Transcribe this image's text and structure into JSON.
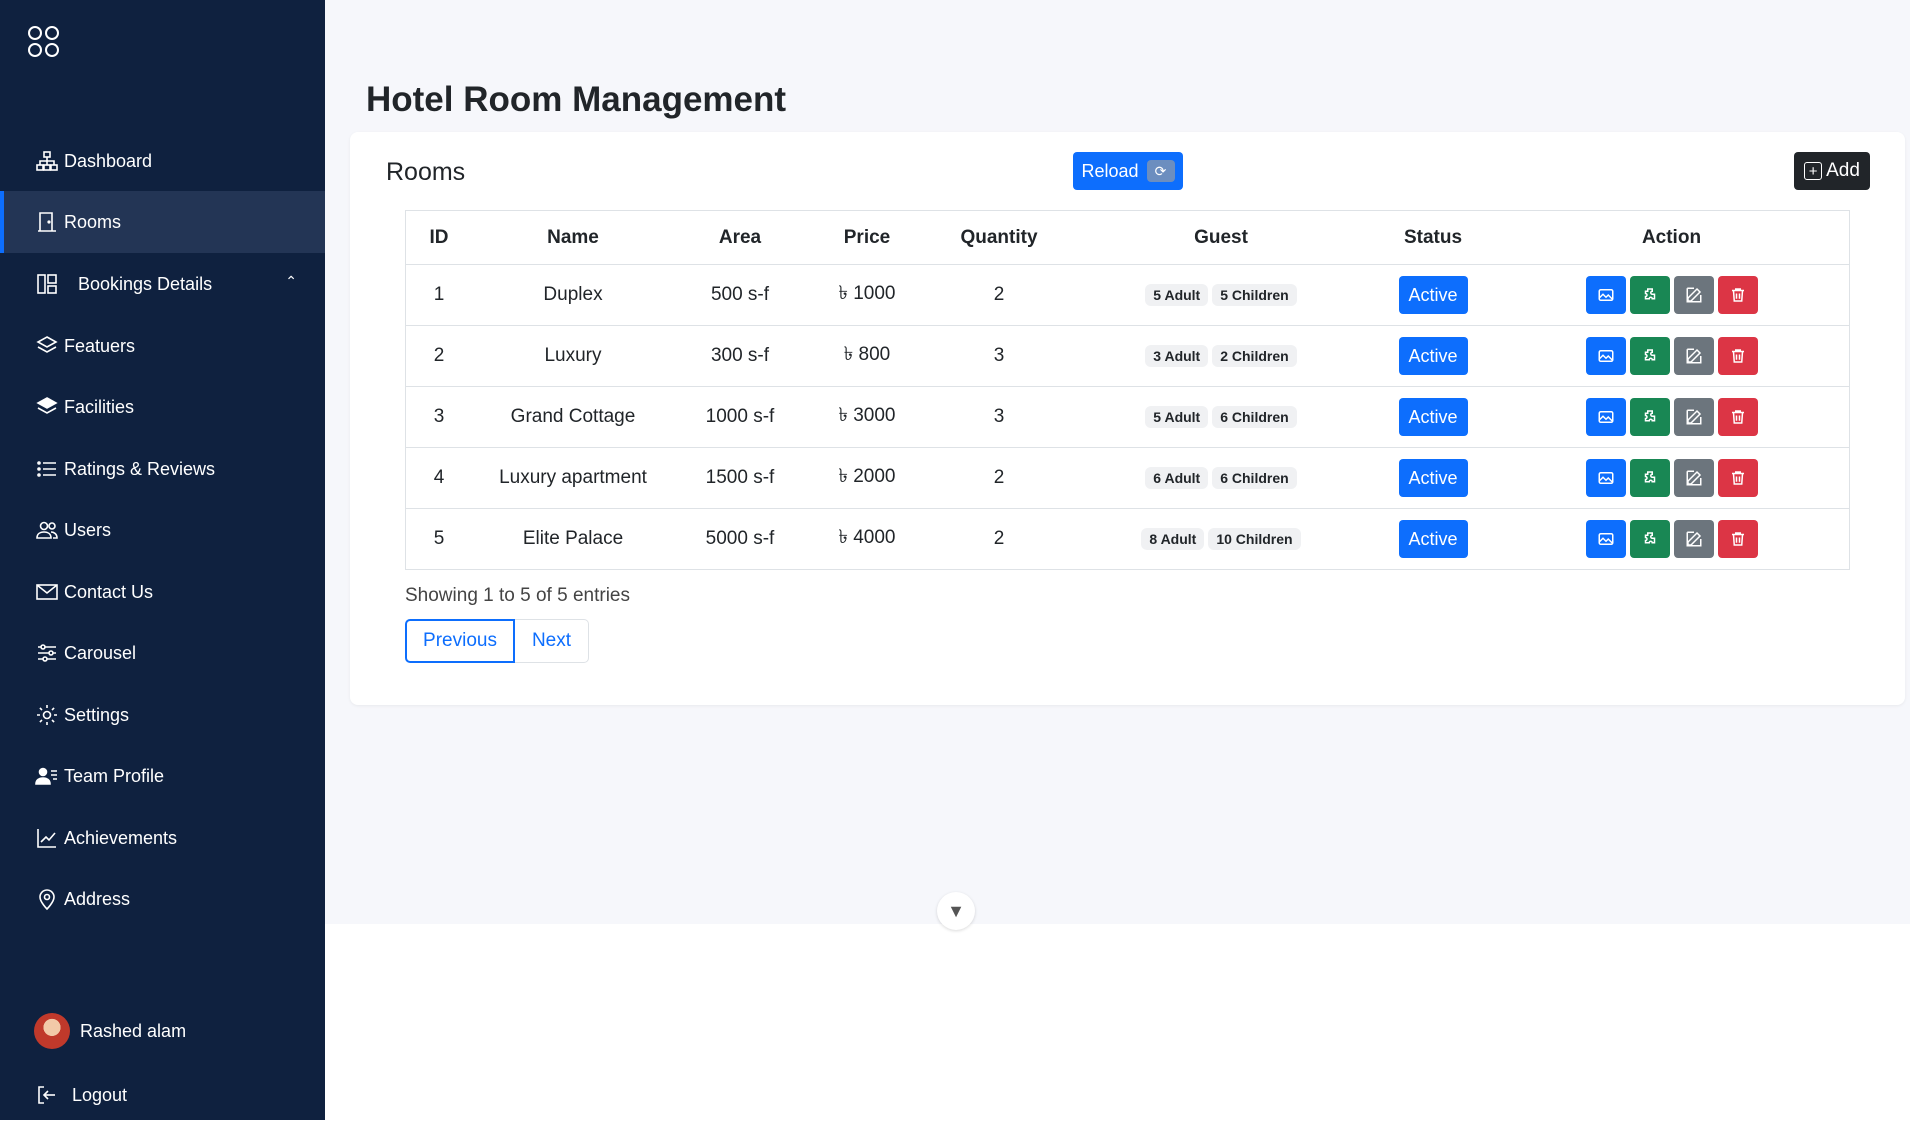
{
  "sidebar": {
    "items": [
      {
        "label": "Dashboard",
        "icon": "diagram-icon",
        "active": false
      },
      {
        "label": "Rooms",
        "icon": "door-icon",
        "active": true
      },
      {
        "label": "Bookings Details",
        "icon": "layout-icon",
        "active": false,
        "expandable": true
      },
      {
        "label": "Featuers",
        "icon": "layers-icon",
        "active": false
      },
      {
        "label": "Facilities",
        "icon": "layers-filled-icon",
        "active": false
      },
      {
        "label": "Ratings & Reviews",
        "icon": "list-icon",
        "active": false
      },
      {
        "label": "Users",
        "icon": "people-icon",
        "active": false
      },
      {
        "label": "Contact Us",
        "icon": "envelope-icon",
        "active": false
      },
      {
        "label": "Carousel",
        "icon": "sliders-icon",
        "active": false
      },
      {
        "label": "Settings",
        "icon": "gear-icon",
        "active": false
      },
      {
        "label": "Team Profile",
        "icon": "person-lines-icon",
        "active": false
      },
      {
        "label": "Achievements",
        "icon": "graph-up-icon",
        "active": false
      },
      {
        "label": "Address",
        "icon": "geo-pin-icon",
        "active": false
      }
    ],
    "user": {
      "name": "Rashed alam"
    },
    "logout_label": "Logout"
  },
  "page": {
    "title": "Hotel Room Management"
  },
  "rooms_card": {
    "title": "Rooms",
    "reload_label": "Reload",
    "add_label": "Add",
    "columns": [
      "ID",
      "Name",
      "Area",
      "Price",
      "Quantity",
      "Guest",
      "Status",
      "Action"
    ],
    "rows": [
      {
        "id": "1",
        "name": "Duplex",
        "area": "500 s-f",
        "price": "৳ 1000",
        "quantity": "2",
        "adult": "5 Adult",
        "children": "5 Children",
        "status": "Active"
      },
      {
        "id": "2",
        "name": "Luxury",
        "area": "300 s-f",
        "price": "৳ 800",
        "quantity": "3",
        "adult": "3 Adult",
        "children": "2 Children",
        "status": "Active"
      },
      {
        "id": "3",
        "name": "Grand Cottage",
        "area": "1000 s-f",
        "price": "৳ 3000",
        "quantity": "3",
        "adult": "5 Adult",
        "children": "6 Children",
        "status": "Active"
      },
      {
        "id": "4",
        "name": "Luxury apartment",
        "area": "1500 s-f",
        "price": "৳ 2000",
        "quantity": "2",
        "adult": "6 Adult",
        "children": "6 Children",
        "status": "Active"
      },
      {
        "id": "5",
        "name": "Elite Palace",
        "area": "5000 s-f",
        "price": "৳ 4000",
        "quantity": "2",
        "adult": "8 Adult",
        "children": "10 Children",
        "status": "Active"
      }
    ],
    "showing_text": "Showing 1 to 5 of 5 entries",
    "pagination": {
      "previous": "Previous",
      "next": "Next"
    }
  },
  "colors": {
    "sidebar_bg": "#0f213f",
    "primary": "#0d6efd",
    "success": "#198754",
    "secondary": "#6c757d",
    "danger": "#dc3545"
  }
}
